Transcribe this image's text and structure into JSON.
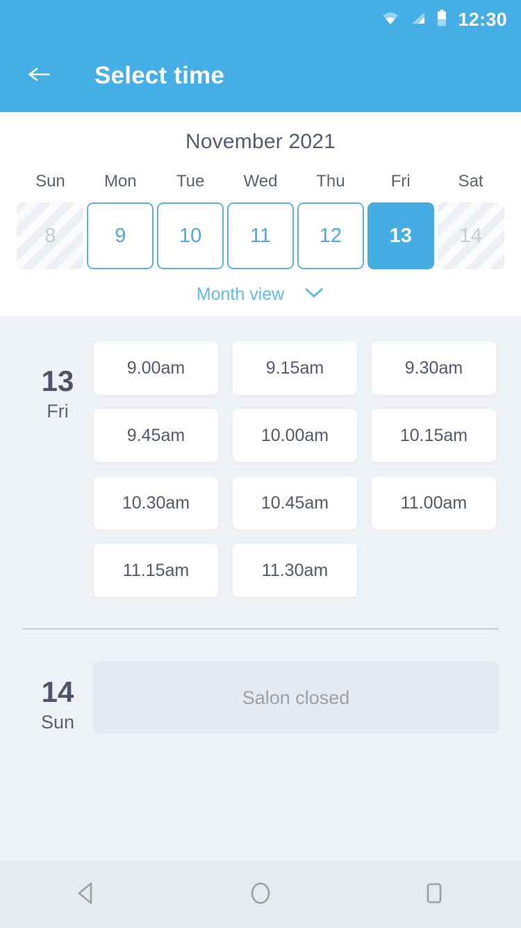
{
  "status_bar": {
    "time": "12:30",
    "icons": [
      "wifi-icon",
      "signal-icon",
      "battery-icon"
    ]
  },
  "app_bar": {
    "back_icon": "arrow-left-icon",
    "title": "Select time"
  },
  "calendar": {
    "month_label": "November 2021",
    "weekdays": [
      "Sun",
      "Mon",
      "Tue",
      "Wed",
      "Thu",
      "Fri",
      "Sat"
    ],
    "days": [
      {
        "number": "8",
        "state": "disabled"
      },
      {
        "number": "9",
        "state": "available"
      },
      {
        "number": "10",
        "state": "available"
      },
      {
        "number": "11",
        "state": "available"
      },
      {
        "number": "12",
        "state": "available"
      },
      {
        "number": "13",
        "state": "selected"
      },
      {
        "number": "14",
        "state": "disabled"
      }
    ],
    "month_view_label": "Month view",
    "month_view_icon": "chevron-down-icon"
  },
  "schedule": [
    {
      "day_number": "13",
      "day_name": "Fri",
      "slots": [
        "9.00am",
        "9.15am",
        "9.30am",
        "9.45am",
        "10.00am",
        "10.15am",
        "10.30am",
        "10.45am",
        "11.00am",
        "11.15am",
        "11.30am"
      ]
    },
    {
      "day_number": "14",
      "day_name": "Sun",
      "closed_message": "Salon closed"
    }
  ],
  "nav_bar": {
    "back": "nav-back-icon",
    "home": "nav-home-icon",
    "recents": "nav-recents-icon"
  },
  "colors": {
    "accent": "#45AEE5",
    "accent_border": "#5cb3e0",
    "background": "#eef1f6",
    "panel": "#ffffff",
    "text_dark": "#4b566b",
    "text_muted": "#5b6474",
    "closed_box": "#e6e9ef"
  }
}
